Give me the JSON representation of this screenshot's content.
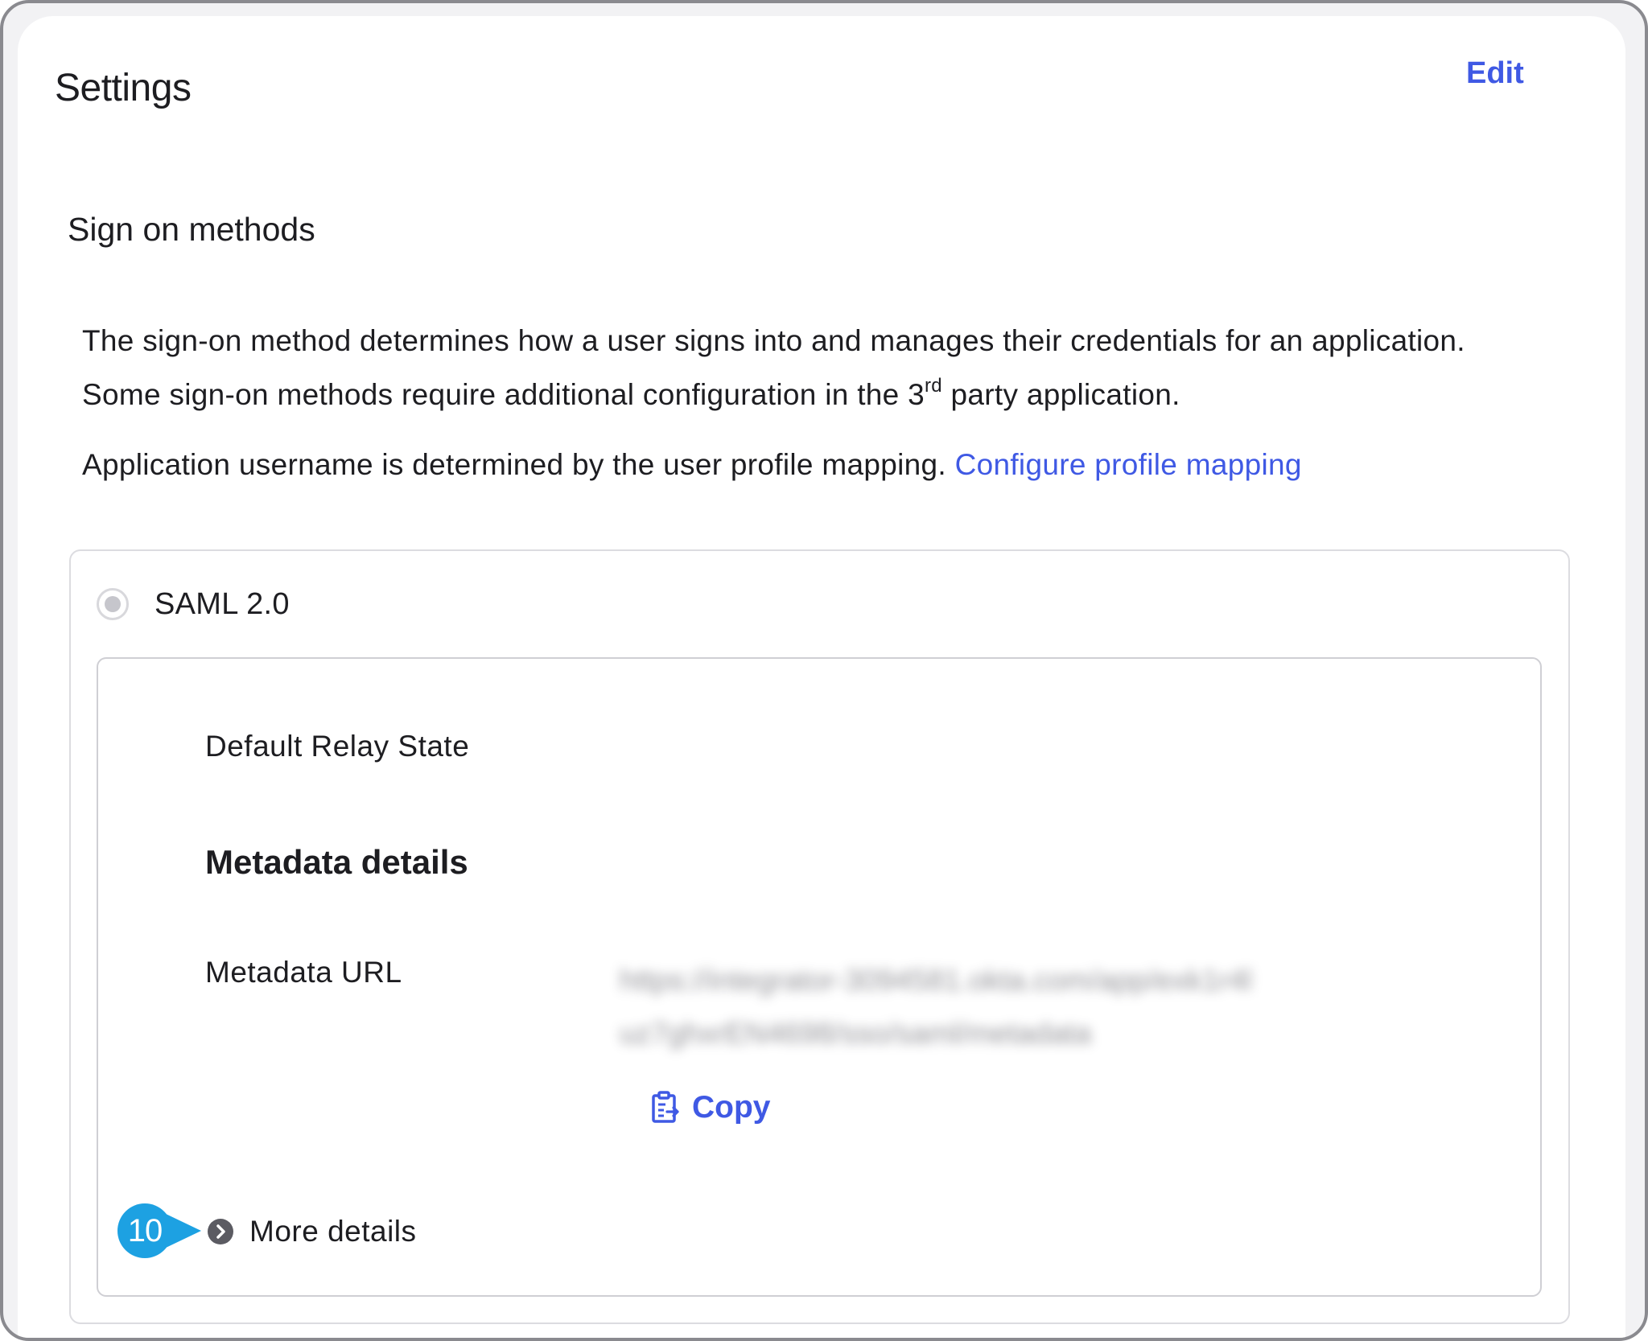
{
  "header": {
    "title": "Settings",
    "edit_label": "Edit"
  },
  "sign_on": {
    "section_title": "Sign on methods",
    "description_part1": "The sign-on method determines how a user signs into and manages their credentials for an application. Some sign-on methods require additional configuration in the 3",
    "description_sup": "rd",
    "description_part2": " party application.",
    "username_text": "Application username is determined by the user profile mapping. ",
    "configure_link": "Configure profile mapping"
  },
  "method": {
    "radio_label": "SAML 2.0",
    "selected": false,
    "relay_state_label": "Default Relay State",
    "metadata_title": "Metadata details",
    "metadata_url_label": "Metadata URL",
    "metadata_url_value": "https://integrator-3094581.okta.com/app/exk1r4luz7ghxrEN4698/sso/saml/metadata",
    "copy_label": "Copy",
    "more_details_label": "More details"
  },
  "callout": {
    "number": "10"
  },
  "colors": {
    "accent": "#3f59e4",
    "callout": "#1da1e2",
    "text": "#1d1d21"
  },
  "icons": {
    "copy": "clipboard-copy-icon",
    "more_details": "chevron-right-circle-icon"
  }
}
